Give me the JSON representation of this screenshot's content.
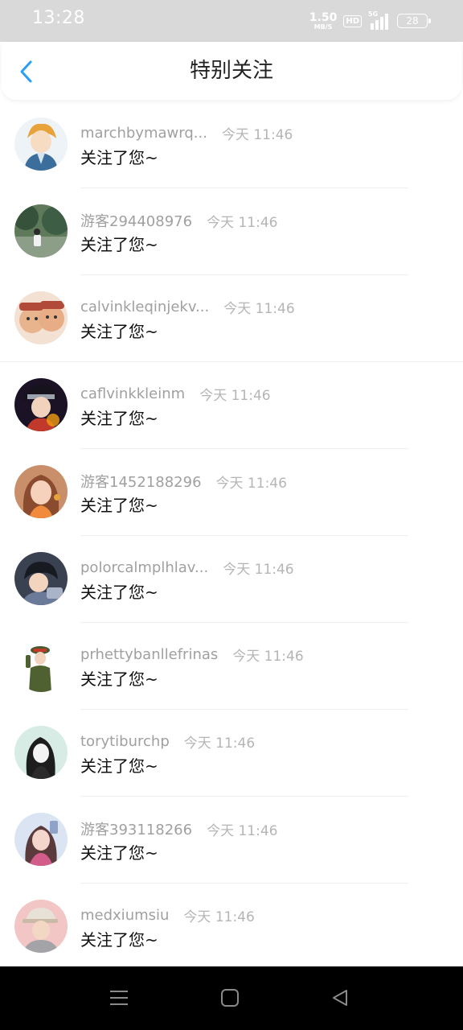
{
  "status_bar": {
    "time": "13:28",
    "net_speed_value": "1.50",
    "net_speed_unit": "MB/S",
    "hd_badge": "HD",
    "signal_tag": "5G",
    "battery": "28",
    "icons": [
      "hd-icon",
      "signal-icon",
      "battery-icon"
    ]
  },
  "header": {
    "title": "特别关注",
    "back_icon": "chevron-left-icon",
    "accent_color": "#2a9df4"
  },
  "notifications": [
    {
      "name": "marchbymawrq...",
      "time": "今天 11:46",
      "message": "关注了您~",
      "avatar": "anime-boy-avatar"
    },
    {
      "name": "游客294408976",
      "time": "今天 11:46",
      "message": "关注了您~",
      "avatar": "landscape-avatar"
    },
    {
      "name": "calvinkleqinjekv...",
      "time": "今天 11:46",
      "message": "关注了您~",
      "avatar": "cartoon-faces-avatar"
    },
    {
      "name": "caflvinkkleinm",
      "time": "今天 11:46",
      "message": "关注了您~",
      "avatar": "ninja-avatar"
    },
    {
      "name": "游客1452188296",
      "time": "今天 11:46",
      "message": "关注了您~",
      "avatar": "girl-avatar"
    },
    {
      "name": "polorcalmplhlav...",
      "time": "今天 11:46",
      "message": "关注了您~",
      "avatar": "anime-detective-avatar"
    },
    {
      "name": "prhettybanllefrinas",
      "time": "今天 11:46",
      "message": "关注了您~",
      "avatar": "soldier-avatar"
    },
    {
      "name": "torytiburchp",
      "time": "今天 11:46",
      "message": "关注了您~",
      "avatar": "sketch-girl-avatar"
    },
    {
      "name": "游客393118266",
      "time": "今天 11:46",
      "message": "关注了您~",
      "avatar": "selfie-girl-avatar"
    },
    {
      "name": "medxiumsiu",
      "time": "今天 11:46",
      "message": "关注了您~",
      "avatar": "cap-boy-avatar"
    }
  ],
  "nav_bar": {
    "icons": [
      "menu-icon",
      "home-icon",
      "back-triangle-icon"
    ]
  }
}
